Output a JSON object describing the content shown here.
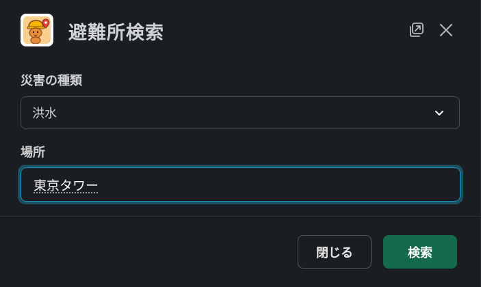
{
  "modal": {
    "title": "避難所検索"
  },
  "fields": {
    "disaster_type": {
      "label": "災害の種類",
      "selected": "洪水"
    },
    "location": {
      "label": "場所",
      "value": "東京タワー"
    }
  },
  "footer": {
    "close_label": "閉じる",
    "search_label": "検索"
  },
  "icons": {
    "app": "shelter-app-icon",
    "popout": "popout-icon",
    "close": "close-icon",
    "chevron": "chevron-down-icon"
  },
  "colors": {
    "background": "#1a1d21",
    "primary_button": "#146a4d",
    "focus_border": "#1d9bd1",
    "text": "#d1d2d3"
  }
}
